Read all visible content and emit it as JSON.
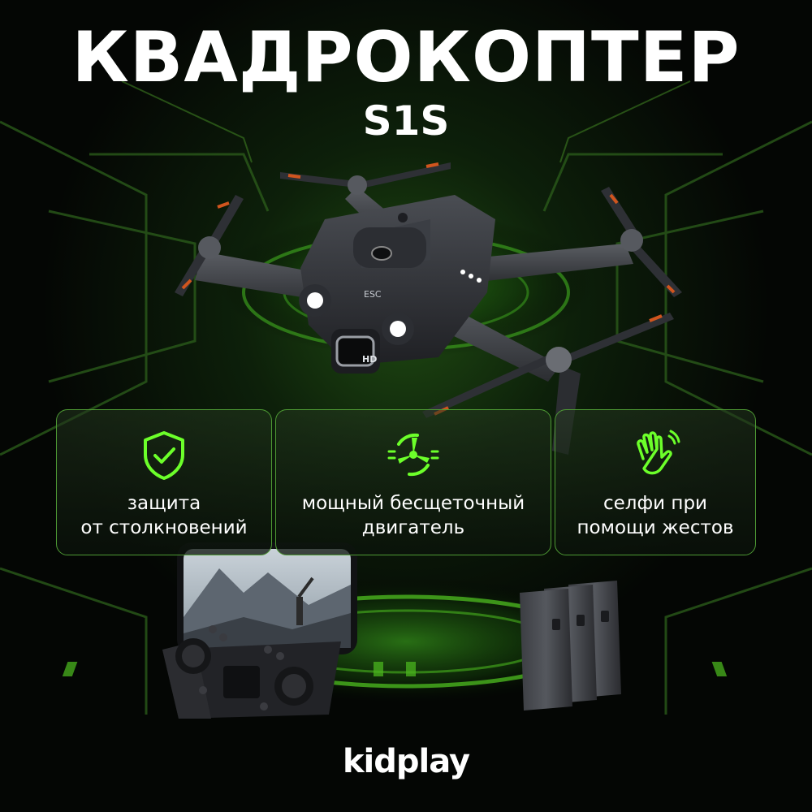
{
  "header": {
    "title": "КВАДРОКОПТЕР",
    "model": "S1S"
  },
  "features": [
    {
      "icon": "shield-check-icon",
      "line1": "защита",
      "line2": "от столкновений"
    },
    {
      "icon": "brushless-motor-icon",
      "line1": "мощный бесщеточный",
      "line2": "двигатель"
    },
    {
      "icon": "waving-hand-icon",
      "line1": "селфи при",
      "line2": "помощи жестов"
    }
  ],
  "drone": {
    "body_badge": "ESC",
    "camera_badge": "HD"
  },
  "brand": {
    "name": "kidplay"
  },
  "colors": {
    "accent": "#6cff2a",
    "card_border": "#4e9a34",
    "background": "#050805"
  }
}
